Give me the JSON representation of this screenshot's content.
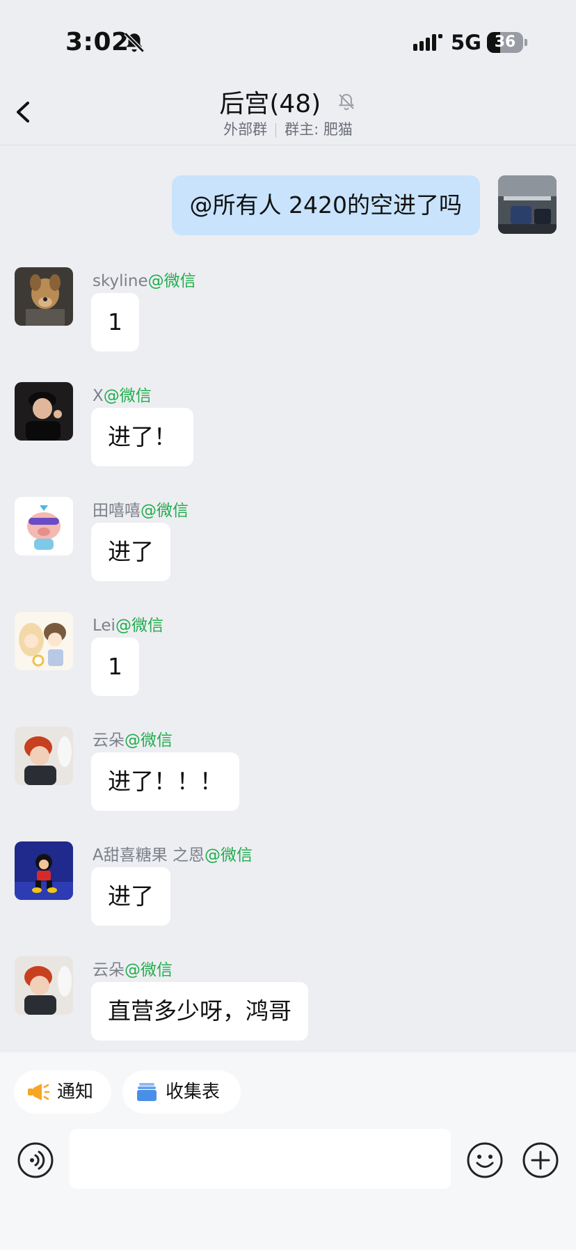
{
  "status_bar": {
    "time": "3:02",
    "network": "5G",
    "battery_level": "36",
    "battery_fraction": 0.36
  },
  "header": {
    "title": "后宫(48)",
    "group_type": "外部群",
    "owner": "群主: 肥猫",
    "icons": {
      "back": "chevron-left-icon",
      "muted": "bell-off-icon"
    }
  },
  "messages": [
    {
      "self": true,
      "text": "@所有人 2420的空进了吗"
    },
    {
      "sender": "skyline",
      "source": "@微信",
      "text": "1"
    },
    {
      "sender": "X",
      "source": "@微信",
      "text": "进了！"
    },
    {
      "sender": "田嘻嘻",
      "source": "@微信",
      "text": "进了"
    },
    {
      "sender": "Lei",
      "source": "@微信",
      "text": "1"
    },
    {
      "sender": "云朵",
      "source": "@微信",
      "text": "进了！！！"
    },
    {
      "sender": "A甜喜糖果 之恩",
      "source": "@微信",
      "text": "进了"
    },
    {
      "sender": "云朵",
      "source": "@微信",
      "text": "直营多少呀，鸿哥"
    }
  ],
  "toolbar": {
    "chips": [
      {
        "label": "通知",
        "icon": "megaphone-icon"
      },
      {
        "label": "收集表",
        "icon": "folder-icon"
      }
    ]
  },
  "input": {
    "value": "",
    "placeholder": "",
    "icons": {
      "voice": "voice-icon",
      "emoji": "emoji-icon",
      "more": "plus-icon"
    }
  },
  "colors": {
    "background": "#edeef2",
    "self_bubble": "#c8e3fb",
    "other_bubble": "#ffffff",
    "source_tag": "#1fad4b",
    "chip_megaphone": "#f5a623",
    "chip_folder": "#4a8fe7"
  }
}
